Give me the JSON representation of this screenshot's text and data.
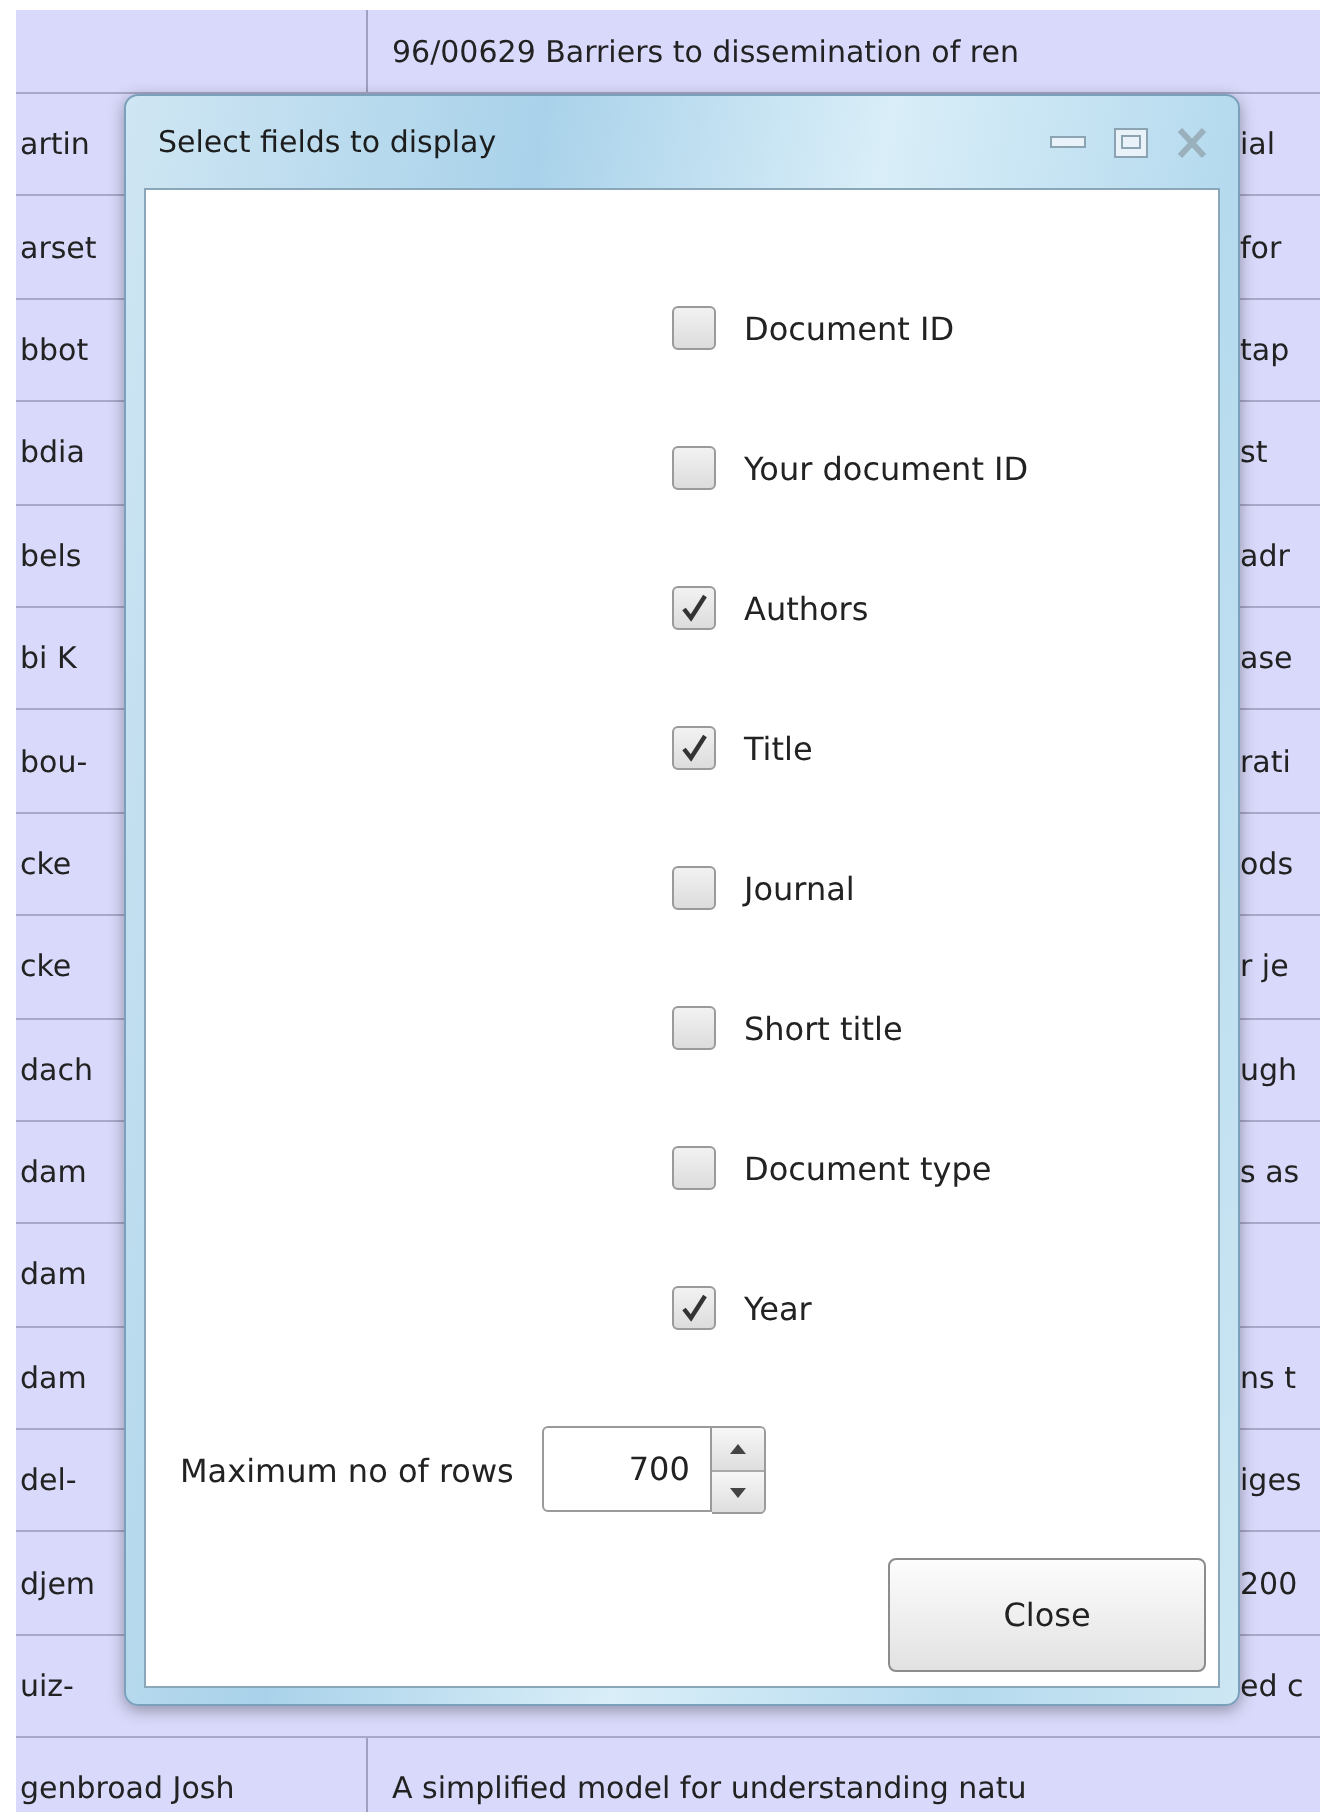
{
  "table": {
    "rows": [
      {
        "cells": [
          "",
          "96/00629 Barriers to dissemination of ren"
        ]
      },
      {
        "cells": [
          "artin",
          "ial"
        ]
      },
      {
        "cells": [
          "arset",
          "for"
        ]
      },
      {
        "cells": [
          "bbot",
          "tap"
        ]
      },
      {
        "cells": [
          "bdia",
          "st"
        ]
      },
      {
        "cells": [
          "bels",
          "adr"
        ]
      },
      {
        "cells": [
          "bi K",
          "ase"
        ]
      },
      {
        "cells": [
          "bou-",
          "rati"
        ]
      },
      {
        "cells": [
          "cke",
          "ods"
        ]
      },
      {
        "cells": [
          "cke",
          "r je"
        ]
      },
      {
        "cells": [
          "dach",
          "ugh"
        ]
      },
      {
        "cells": [
          "dam",
          "s as"
        ]
      },
      {
        "cells": [
          "dam",
          ""
        ]
      },
      {
        "cells": [
          "dam",
          "ns t"
        ]
      },
      {
        "cells": [
          "del-",
          "iges"
        ]
      },
      {
        "cells": [
          "djem",
          "200"
        ]
      },
      {
        "cells": [
          "uiz-",
          "ed c"
        ]
      },
      {
        "cells": [
          "genbroad Josh",
          "A simplified model for understanding natu"
        ]
      }
    ]
  },
  "dialog": {
    "title": "Select fields to display",
    "fields": [
      {
        "label": "Document ID",
        "checked": false
      },
      {
        "label": "Your document ID",
        "checked": false
      },
      {
        "label": "Authors",
        "checked": true
      },
      {
        "label": "Title",
        "checked": true
      },
      {
        "label": "Journal",
        "checked": false
      },
      {
        "label": "Short title",
        "checked": false
      },
      {
        "label": "Document type",
        "checked": false
      },
      {
        "label": "Year",
        "checked": true
      }
    ],
    "max_rows": {
      "label": "Maximum no of rows",
      "value": "700"
    },
    "close_button": "Close"
  }
}
